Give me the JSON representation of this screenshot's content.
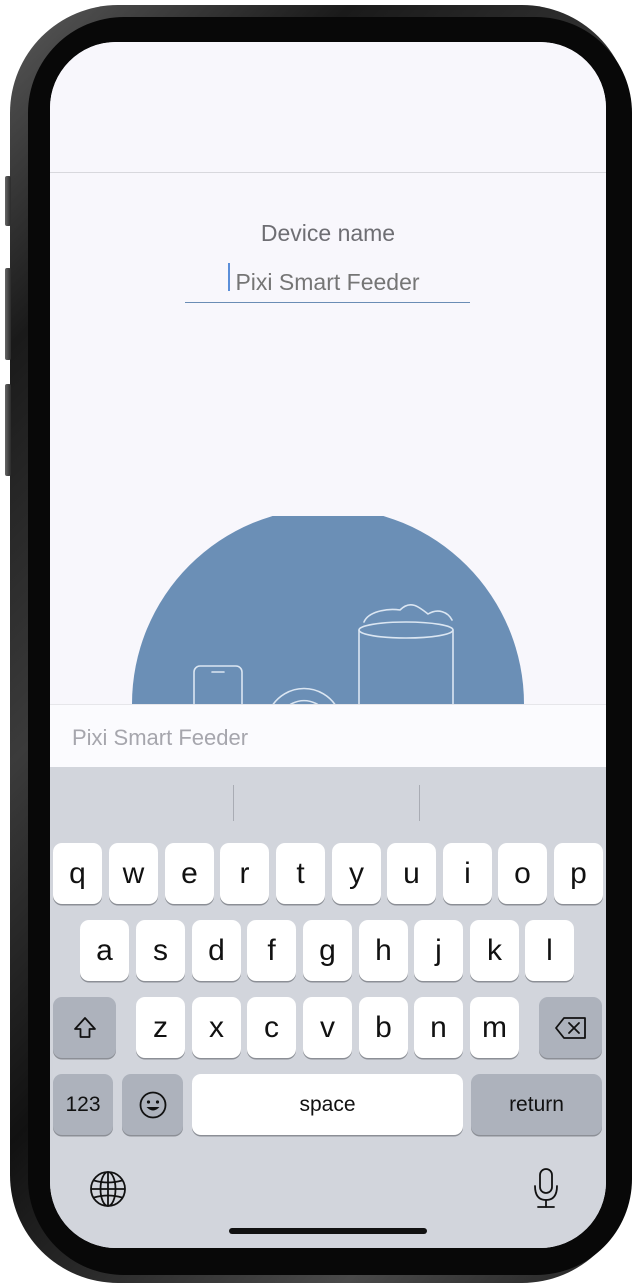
{
  "field": {
    "label": "Device name",
    "placeholder": "Pixi Smart Feeder"
  },
  "suggestion": {
    "text": "Pixi Smart Feeder"
  },
  "keyboard": {
    "row1": [
      "q",
      "w",
      "e",
      "r",
      "t",
      "y",
      "u",
      "i",
      "o",
      "p"
    ],
    "row2": [
      "a",
      "s",
      "d",
      "f",
      "g",
      "h",
      "j",
      "k",
      "l"
    ],
    "row3": [
      "z",
      "x",
      "c",
      "v",
      "b",
      "n",
      "m"
    ],
    "numbers_label": "123",
    "space_label": "space",
    "return_label": "return"
  },
  "colors": {
    "accent": "#6a8db5",
    "illustration_fill": "#6b8fb6"
  }
}
